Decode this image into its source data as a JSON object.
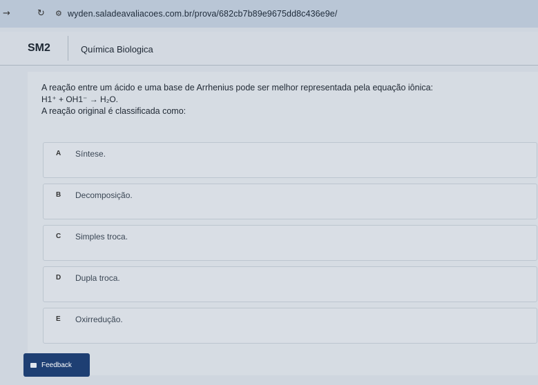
{
  "browser": {
    "url": "wyden.saladeavaliacoes.com.br/prova/682cb7b89e9675dd8c436e9e/"
  },
  "course": {
    "code": "SM2",
    "name": "Química Biologica"
  },
  "question": {
    "prompt": "A reação entre um ácido e uma base de Arrhenius pode ser melhor representada pela equação iônica:",
    "equation": "H1⁺ + OH1⁻ → H₂O.",
    "ask": "A reação original é classificada como:",
    "options": [
      {
        "letter": "A",
        "text": "Síntese."
      },
      {
        "letter": "B",
        "text": "Decomposição."
      },
      {
        "letter": "C",
        "text": "Simples troca."
      },
      {
        "letter": "D",
        "text": "Dupla troca."
      },
      {
        "letter": "E",
        "text": "Oxirredução."
      }
    ]
  },
  "actions": {
    "feedback_label": "Feedback"
  },
  "icons": {
    "forward": "forward-arrow-icon",
    "reload": "reload-icon",
    "site_settings": "site-settings-icon",
    "feedback": "feedback-icon"
  },
  "colors": {
    "feedback_button": "#1e3f73"
  }
}
